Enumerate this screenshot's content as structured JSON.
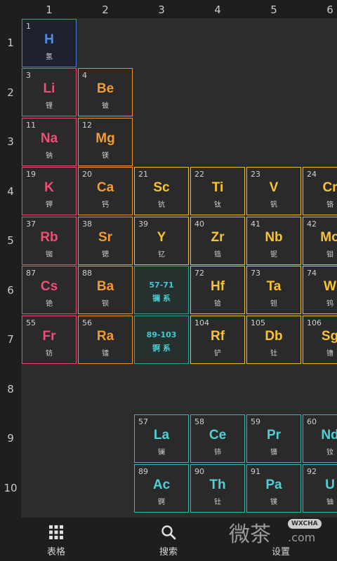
{
  "col_headers": [
    "1",
    "2",
    "3",
    "4",
    "5",
    "6"
  ],
  "row_headers": [
    "1",
    "2",
    "3",
    "4",
    "5",
    "6",
    "7",
    "8",
    "9",
    "10"
  ],
  "elements": {
    "H": {
      "num": "1",
      "sym": "H",
      "cn": "氢"
    },
    "Li": {
      "num": "3",
      "sym": "Li",
      "cn": "锂"
    },
    "Be": {
      "num": "4",
      "sym": "Be",
      "cn": "铍"
    },
    "Na": {
      "num": "11",
      "sym": "Na",
      "cn": "钠"
    },
    "Mg": {
      "num": "12",
      "sym": "Mg",
      "cn": "镁"
    },
    "K": {
      "num": "19",
      "sym": "K",
      "cn": "钾"
    },
    "Ca": {
      "num": "20",
      "sym": "Ca",
      "cn": "钙"
    },
    "Sc": {
      "num": "21",
      "sym": "Sc",
      "cn": "钪"
    },
    "Ti": {
      "num": "22",
      "sym": "Ti",
      "cn": "钛"
    },
    "V": {
      "num": "23",
      "sym": "V",
      "cn": "钒"
    },
    "Cr": {
      "num": "24",
      "sym": "Cr",
      "cn": "铬"
    },
    "Rb": {
      "num": "37",
      "sym": "Rb",
      "cn": "铷"
    },
    "Sr": {
      "num": "38",
      "sym": "Sr",
      "cn": "锶"
    },
    "Y": {
      "num": "39",
      "sym": "Y",
      "cn": "钇"
    },
    "Zr": {
      "num": "40",
      "sym": "Zr",
      "cn": "锆"
    },
    "Nb": {
      "num": "41",
      "sym": "Nb",
      "cn": "铌"
    },
    "Mo": {
      "num": "42",
      "sym": "Mo",
      "cn": "钼"
    },
    "Cs": {
      "num": "87",
      "sym": "Cs",
      "cn": "铯"
    },
    "Ba": {
      "num": "88",
      "sym": "Ba",
      "cn": "钡"
    },
    "Hf": {
      "num": "72",
      "sym": "Hf",
      "cn": "铪"
    },
    "Ta": {
      "num": "73",
      "sym": "Ta",
      "cn": "钽"
    },
    "W": {
      "num": "74",
      "sym": "W",
      "cn": "钨"
    },
    "Fr": {
      "num": "55",
      "sym": "Fr",
      "cn": "钫"
    },
    "Ra": {
      "num": "56",
      "sym": "Ra",
      "cn": "镭"
    },
    "Rf": {
      "num": "104",
      "sym": "Rf",
      "cn": "铲"
    },
    "Db": {
      "num": "105",
      "sym": "Db",
      "cn": "钍"
    },
    "Sg": {
      "num": "106",
      "sym": "Sg",
      "cn": "镥"
    },
    "La": {
      "num": "57",
      "sym": "La",
      "cn": "镧"
    },
    "Ce": {
      "num": "58",
      "sym": "Ce",
      "cn": "铈"
    },
    "Pr": {
      "num": "59",
      "sym": "Pr",
      "cn": "镨"
    },
    "Nd": {
      "num": "60",
      "sym": "Nd",
      "cn": "钕"
    },
    "Ac": {
      "num": "89",
      "sym": "Ac",
      "cn": "锕"
    },
    "Th": {
      "num": "90",
      "sym": "Th",
      "cn": "钍"
    },
    "Pa": {
      "num": "91",
      "sym": "Pa",
      "cn": "镤"
    },
    "U": {
      "num": "92",
      "sym": "U",
      "cn": "铀"
    }
  },
  "placeholders": {
    "lanthanides": {
      "range": "57-71",
      "label": "镧 系"
    },
    "actinides": {
      "range": "89-103",
      "label": "锕 系"
    }
  },
  "nav": {
    "table_label": "表格",
    "search_label": "搜索",
    "settings_label": "设置"
  },
  "watermark": {
    "text": "微茶",
    "badge": "WXCHA",
    "url": ".com"
  },
  "colors": {
    "nonmetal": "#4a8fe8",
    "alkali": "#ee4f74",
    "alkaline_earth": "#f39a30",
    "transition": "#f8c232",
    "lanthanide_actinide": "#4fd0d8"
  }
}
